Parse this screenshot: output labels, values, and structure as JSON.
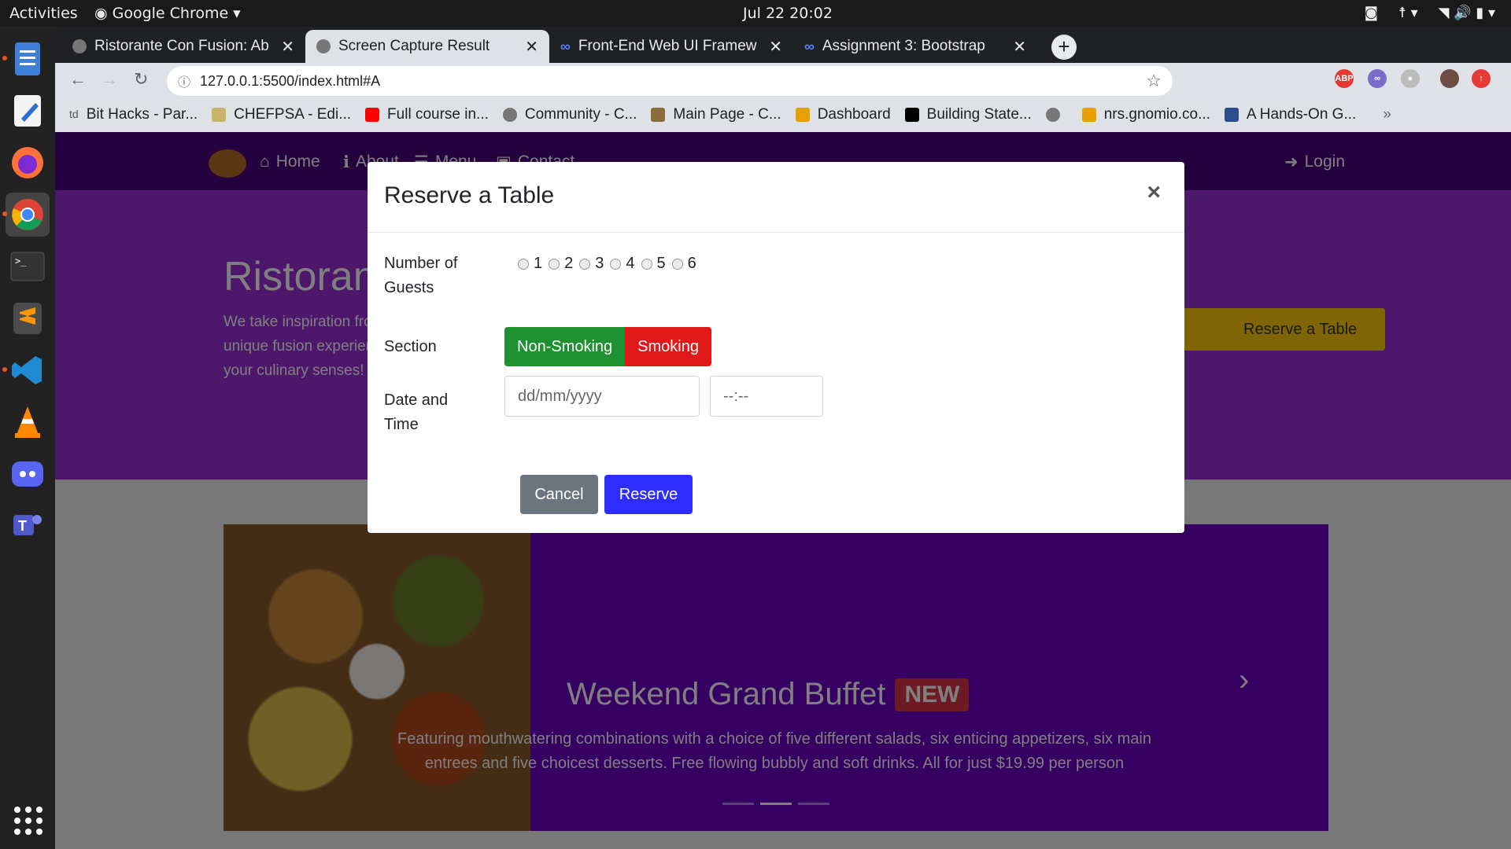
{
  "system": {
    "activities": "Activities",
    "app_name": "Google Chrome",
    "clock": "Jul 22  20:02"
  },
  "browser": {
    "tabs": [
      {
        "title": "Ristorante Con Fusion: Ab",
        "active": false
      },
      {
        "title": "Screen Capture Result",
        "active": true
      },
      {
        "title": "Front-End Web UI Framew",
        "active": false
      },
      {
        "title": "Assignment 3: Bootstrap",
        "active": false
      }
    ],
    "url": "127.0.0.1:5500/index.html#A",
    "bookmarks": [
      {
        "label": "Bit Hacks - Par...",
        "icon_color": "#555555"
      },
      {
        "label": "CHEFPSA - Edi...",
        "icon_color": "#c9b26a"
      },
      {
        "label": "Full course in...",
        "icon_color": "#ff0000"
      },
      {
        "label": "Community - C...",
        "icon_color": "#777777"
      },
      {
        "label": "Main Page - C...",
        "icon_color": "#8a6d3b"
      },
      {
        "label": "Dashboard",
        "icon_color": "#e6a100"
      },
      {
        "label": "Building State...",
        "icon_color": "#000000"
      },
      {
        "label": "",
        "icon_color": "#777777"
      },
      {
        "label": "nrs.gnomio.co...",
        "icon_color": "#e6a100"
      },
      {
        "label": "A Hands-On G...",
        "icon_color": "#2b4f8a"
      }
    ],
    "bookmarks_more": "»"
  },
  "page": {
    "nav": {
      "home": "Home",
      "about": "About",
      "menu": "Menu",
      "contact": "Contact",
      "login": "Login"
    },
    "jumbotron": {
      "title": "Ristorante con Fusion",
      "text": "We take inspiration from the World's best cuisines, and create a unique fusion experience. Our lipsmacking creations will tickle your culinary senses!",
      "reserve_button": "Reserve a Table"
    },
    "carousel": {
      "title": "Weekend Grand Buffet",
      "badge": "NEW",
      "text": "Featuring mouthwatering combinations with a choice of five different salads, six enticing appetizers, six main entrees and five choicest desserts. Free flowing bubbly and soft drinks. All for just $19.99 per person",
      "next": "›"
    }
  },
  "modal": {
    "title": "Reserve a Table",
    "close": "×",
    "guests_label": "Number of Guests",
    "guest_options": [
      "1",
      "2",
      "3",
      "4",
      "5",
      "6"
    ],
    "section_label": "Section",
    "section_options": {
      "non_smoking": "Non-Smoking",
      "smoking": "Smoking"
    },
    "datetime_label": "Date and Time",
    "date_placeholder": "dd/mm/yyyy",
    "time_placeholder": "--:--",
    "cancel": "Cancel",
    "reserve": "Reserve"
  },
  "colors": {
    "nav_purple": "#4a007f",
    "jumbo_purple": "#9b30d8",
    "non_smoking": "#1e9130",
    "smoking": "#e0181a",
    "reserve_blue": "#2d2dff",
    "cancel_gray": "#6c757d",
    "reserve_yellow": "#ffcb0a"
  }
}
